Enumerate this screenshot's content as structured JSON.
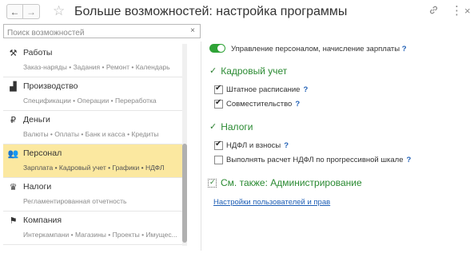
{
  "window": {
    "title": "Больше возможностей: настройка программы",
    "back_glyph": "←",
    "forward_glyph": "→",
    "star_glyph": "☆",
    "link_glyph": "🔗",
    "more_glyph": "⋮",
    "close_glyph": "×"
  },
  "search": {
    "placeholder": "Поиск возможностей",
    "clear_glyph": "×"
  },
  "sections": [
    {
      "icon": "wrench-hammer-icon",
      "glyph": "⚒",
      "title": "Работы",
      "subtitle": "Заказ-наряды • Задания • Ремонт • Календарь",
      "active": false
    },
    {
      "icon": "factory-icon",
      "glyph": "▟",
      "title": "Производство",
      "subtitle": "Спецификации • Операции • Переработка",
      "active": false
    },
    {
      "icon": "ruble-icon",
      "glyph": "₽",
      "title": "Деньги",
      "subtitle": "Валюты • Оплаты • Банк и касса • Кредиты",
      "active": false
    },
    {
      "icon": "people-icon",
      "glyph": "👥",
      "title": "Персонал",
      "subtitle": "Зарплата • Кадровый учет • Графики • НДФЛ",
      "active": true
    },
    {
      "icon": "eagle-emblem-icon",
      "glyph": "♛",
      "title": "Налоги",
      "subtitle": "Регламентированная отчетность",
      "active": false
    },
    {
      "icon": "flag-icon",
      "glyph": "⚑",
      "title": "Компания",
      "subtitle": "Интеркампани • Магазины • Проекты • Имущес...",
      "active": false
    }
  ],
  "main": {
    "toggle_label": "Управление персоналом, начисление зарплаты",
    "toggle_on": true,
    "help_glyph": "?",
    "groups": [
      {
        "title": "Кадровый учет",
        "chevron": "✓",
        "options": [
          {
            "label": "Штатное расписание",
            "checked": true
          },
          {
            "label": "Совместительство",
            "checked": true
          }
        ]
      },
      {
        "title": "Налоги",
        "chevron": "✓",
        "options": [
          {
            "label": "НДФЛ и взносы",
            "checked": true
          },
          {
            "label": "Выполнять расчет НДФЛ по прогрессивной шкале",
            "checked": false
          }
        ]
      }
    ],
    "see_also": "См. также: Администрирование",
    "link": "Настройки пользователей и прав"
  },
  "colors": {
    "accent_green": "#2a8a32",
    "toggle_green": "#2fa337",
    "active_row": "#fbe8a0",
    "link_blue": "#1d5eb5"
  }
}
